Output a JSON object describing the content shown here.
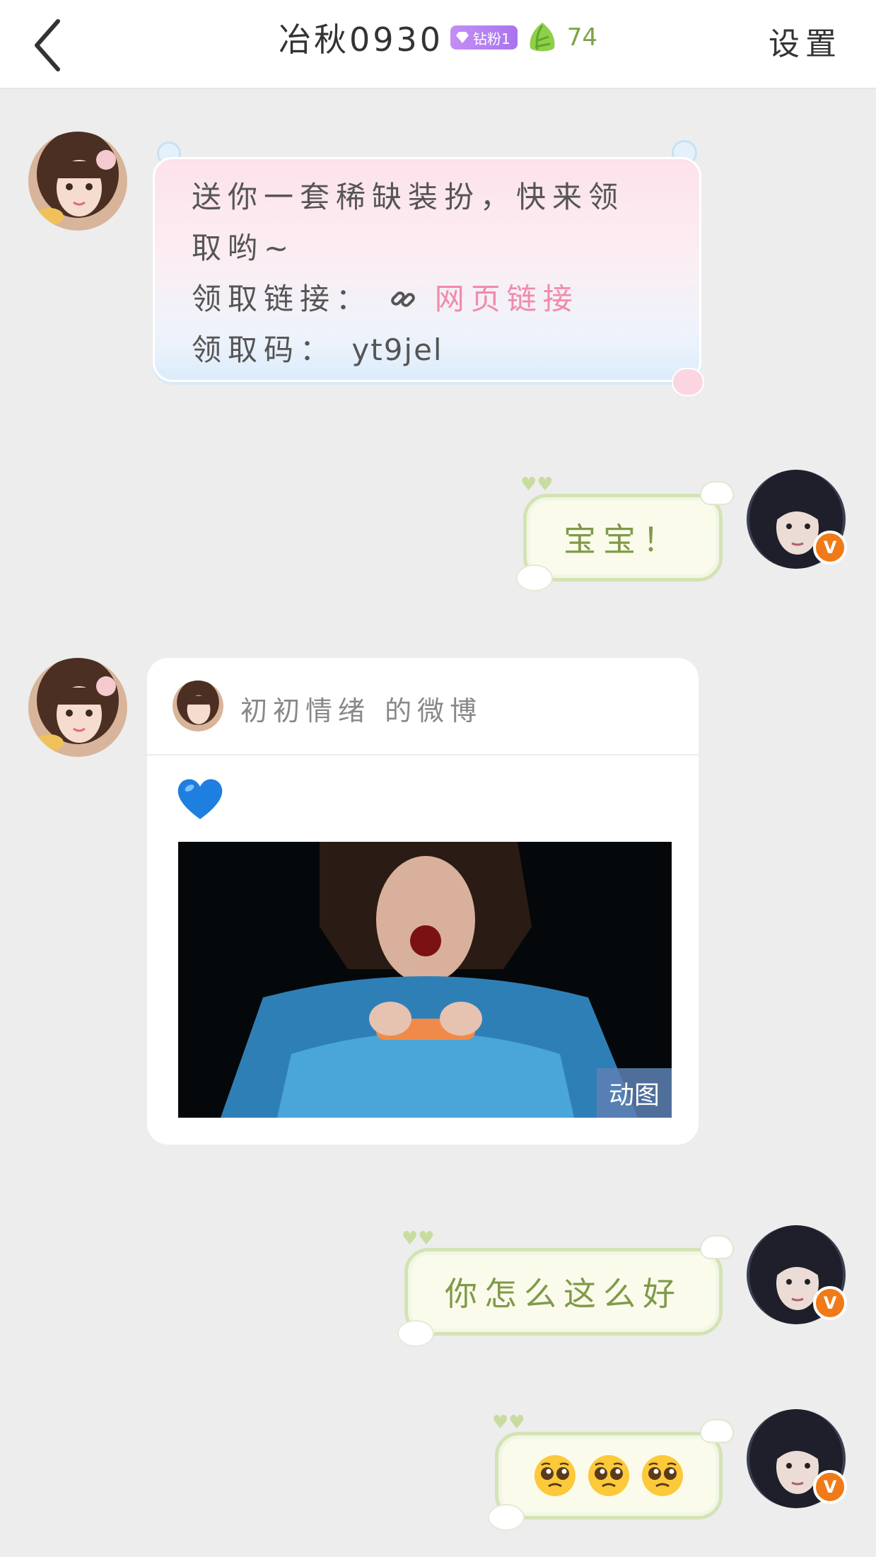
{
  "header": {
    "back_icon": "chevron-left-icon",
    "title": "冶秋0930",
    "fan_badge": "钻粉1",
    "level": "74",
    "settings_label": "设置"
  },
  "messages": {
    "gift": {
      "line1": "送你一套稀缺装扮，快来领",
      "line2": "取哟~",
      "link_label": "领取链接：",
      "link_text": "网页链接",
      "code_label": "领取码：",
      "code_value": "yt9jel"
    },
    "reply1": "宝宝！",
    "weibo": {
      "title": "初初情绪 的微博",
      "emoji": "blue-heart-icon",
      "gif_badge": "动图"
    },
    "reply2": "你怎么这么好",
    "reply3_icon": "pleading-face-emoji"
  },
  "colors": {
    "link_pink": "#f08bab",
    "fan_badge_purple": "#b07ef0",
    "level_green": "#7aa343",
    "bubble_green_text": "#7f9a4a",
    "verified_orange": "#f07a17"
  }
}
